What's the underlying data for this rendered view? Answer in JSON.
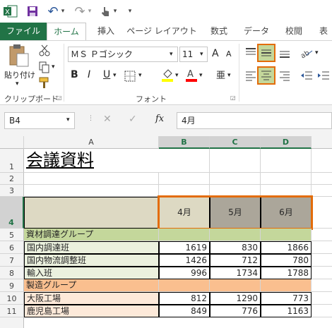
{
  "qat": {
    "undo_label": "↶",
    "redo_label": "↷",
    "dropdown": "▾"
  },
  "tabs": [
    "ファイル",
    "ホーム",
    "挿入",
    "ページ レイアウト",
    "数式",
    "データ",
    "校閲",
    "表"
  ],
  "clipboard": {
    "paste_label": "貼り付け",
    "group_label": "クリップボード"
  },
  "font": {
    "name": "ＭＳ Ｐゴシック",
    "size": "11",
    "grow": "A",
    "shrink": "A",
    "bold": "B",
    "italic": "I",
    "underline": "U",
    "group_label": "フォント",
    "phonetic": "亜"
  },
  "formula_bar": {
    "name_box": "B4",
    "fx": "fx",
    "content": "4月"
  },
  "columns": {
    "corner": "",
    "a": "A",
    "b": "B",
    "c": "C",
    "d": "D"
  },
  "rows": [
    "1",
    "2",
    "3",
    "4",
    "5",
    "6",
    "7",
    "8",
    "9",
    "10",
    "11"
  ],
  "sheet": {
    "title": "会議資料",
    "header": {
      "b": "4月",
      "c": "5月",
      "d": "6月"
    },
    "data": [
      {
        "label": "資材調達グループ",
        "b": "",
        "c": "",
        "d": ""
      },
      {
        "label": "国内調達班",
        "b": "1619",
        "c": "830",
        "d": "1866"
      },
      {
        "label": "国内物流調整班",
        "b": "1426",
        "c": "712",
        "d": "780"
      },
      {
        "label": "輸入班",
        "b": "996",
        "c": "1734",
        "d": "1788"
      },
      {
        "label": "製造グループ",
        "b": "",
        "c": "",
        "d": ""
      },
      {
        "label": "大阪工場",
        "b": "812",
        "c": "1290",
        "d": "773"
      },
      {
        "label": "鹿児島工場",
        "b": "849",
        "c": "776",
        "d": "1163"
      }
    ]
  },
  "colors": {
    "excel_green": "#217346",
    "highlight": "#e36c09",
    "header_gray": "#aba69a",
    "header_beige": "#ddd9c3",
    "group1": "#c4d79b",
    "group1_light": "#ebf1de",
    "group2": "#fabf8f",
    "group2_light": "#fde9d9"
  }
}
